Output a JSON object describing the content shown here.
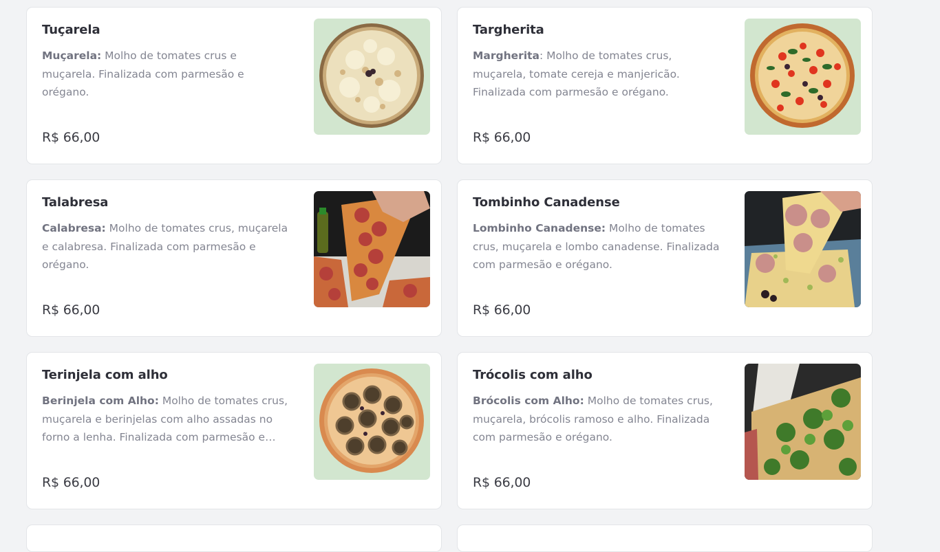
{
  "items": [
    {
      "title": "Tuçarela",
      "highlight": "Muçarela:",
      "description": " Molho de tomates crus e muçarela. Finalizada com parmesão e orégano.",
      "price": "R$ 66,00",
      "image": "pizza-mucarela-image",
      "thumb_bg": "#d2e6cf"
    },
    {
      "title": "Targherita",
      "highlight": "Margherita",
      "description": ": Molho de tomates crus, muçarela, tomate cereja e manjericão. Finalizada com parmesão e orégano.",
      "price": "R$ 66,00",
      "image": "pizza-margherita-image",
      "thumb_bg": "#d2e6cf"
    },
    {
      "title": "Talabresa",
      "highlight": "Calabresa:",
      "description": " Molho de tomates crus, muçarela e calabresa. Finalizada com parmesão e orégano.",
      "price": "R$ 66,00",
      "image": "pizza-calabresa-photo",
      "thumb_bg": "#1a1a1a"
    },
    {
      "title": "Tombinho Canadense",
      "highlight": "Lombinho Canadense:",
      "description": " Molho de tomates crus, muçarela e lombo canadense. Finalizada com parmesão e orégano.",
      "price": "R$ 66,00",
      "image": "pizza-lombinho-photo",
      "thumb_bg": "#202326"
    },
    {
      "title": "Terinjela com alho",
      "highlight": "Berinjela com Alho:",
      "description": " Molho de tomates crus, muçarela e berinjelas com alho assadas no forno a lenha. Finalizada com parmesão e orégano.",
      "price": "R$ 66,00",
      "image": "pizza-berinjela-image",
      "thumb_bg": "#d2e6cf"
    },
    {
      "title": "Trócolis com alho",
      "highlight": "Brócolis com Alho:",
      "description": " Molho de tomates crus, muçarela, brócolis ramoso e alho. Finalizada com parmesão e orégano.",
      "price": "R$ 66,00",
      "image": "pizza-brocolis-photo",
      "thumb_bg": "#2a2a2a"
    }
  ]
}
